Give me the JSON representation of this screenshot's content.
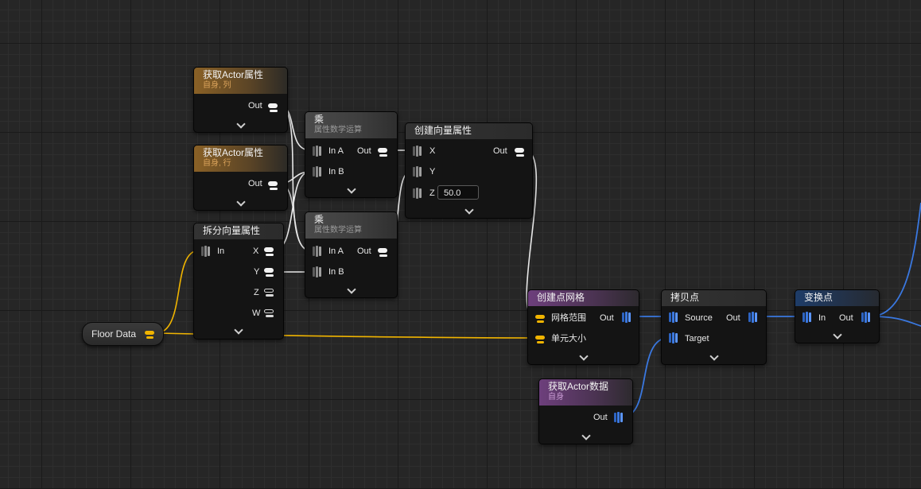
{
  "nodes": {
    "get_actor_col": {
      "title": "获取Actor属性",
      "subtitle": "自身, 列",
      "out": "Out"
    },
    "get_actor_row": {
      "title": "获取Actor属性",
      "subtitle": "自身, 行",
      "out": "Out"
    },
    "break_vector": {
      "title": "拆分向量属性",
      "in": "In",
      "x": "X",
      "y": "Y",
      "z": "Z",
      "w": "W"
    },
    "multiply_1": {
      "title": "乘",
      "subtitle": "属性数学运算",
      "in_a": "In A",
      "in_b": "In B",
      "out": "Out"
    },
    "multiply_2": {
      "title": "乘",
      "subtitle": "属性数学运算",
      "in_a": "In A",
      "in_b": "In B",
      "out": "Out"
    },
    "make_vector": {
      "title": "创建向量属性",
      "x": "X",
      "y": "Y",
      "z": "Z",
      "z_value": "50.0",
      "out": "Out"
    },
    "floor_data": {
      "label": "Floor Data"
    },
    "create_grid": {
      "title": "创建点网格",
      "grid_extents": "网格范围",
      "cell_size": "单元大小",
      "out": "Out"
    },
    "get_actor_data": {
      "title": "获取Actor数据",
      "subtitle": "自身",
      "out": "Out"
    },
    "copy_points": {
      "title": "拷贝点",
      "source": "Source",
      "target": "Target",
      "out": "Out"
    },
    "transform_points": {
      "title": "变换点",
      "in": "In",
      "out": "Out"
    }
  },
  "colors": {
    "canvas": "#262626",
    "wire_white": "#e8e8e8",
    "wire_yellow": "#f0b400",
    "wire_blue": "#3a78e0",
    "header_orange": "#8a6126",
    "header_purple": "#6d3f7c",
    "header_blue": "#1e3c68"
  }
}
